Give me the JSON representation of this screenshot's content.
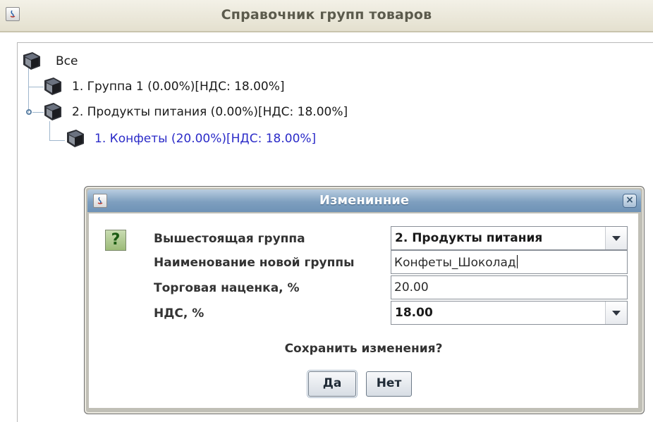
{
  "window": {
    "title": "Справочник групп товаров"
  },
  "tree": {
    "root": {
      "label": "Все",
      "icon": "book-icon"
    },
    "nodes": [
      {
        "label": "1. Группа 1 (0.00%)[НДС: 18.00%]",
        "icon": "book-icon"
      },
      {
        "label": "2. Продукты питания (0.00%)[НДС: 18.00%]",
        "icon": "book-icon",
        "expanded": true
      },
      {
        "label": "1. Конфеты (20.00%)[НДС: 18.00%]",
        "icon": "book-icon",
        "selected": true
      }
    ]
  },
  "dialog": {
    "title": "Изменинние",
    "icon": "question-icon",
    "fields": {
      "parent_group": {
        "label": "Вышестоящая группа",
        "value": "2. Продукты питания"
      },
      "new_group_name": {
        "label": "Наименование новой группы",
        "value": "Конфеты_Шоколад"
      },
      "markup": {
        "label": "Торговая наценка, %",
        "value": "20.00"
      },
      "vat": {
        "label": "НДС, %",
        "value": "18.00"
      }
    },
    "prompt": "Сохранить изменения?",
    "buttons": {
      "yes": "Да",
      "no": "Нет"
    },
    "close_symbol": "×"
  },
  "colors": {
    "title_text": "#5b5a4c",
    "selected_node": "#2b2bc8",
    "dialog_title_bar": "#7e9fbf"
  }
}
